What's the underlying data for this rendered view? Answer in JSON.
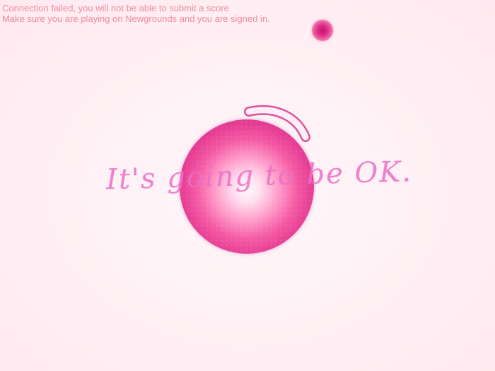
{
  "status": {
    "line1": "Connection failed, you will not be able to submit a score",
    "line2": "Make sure you are playing on Newgrounds and you are signed in."
  },
  "message": "It's going to be OK.",
  "colors": {
    "background": "#fff1f5",
    "status_text": "#ef8b9c",
    "orb_core": "#e63d94",
    "orb_rim": "#9c2f9f",
    "message_text": "#ec70c4",
    "arc_stroke": "#d9559c"
  }
}
